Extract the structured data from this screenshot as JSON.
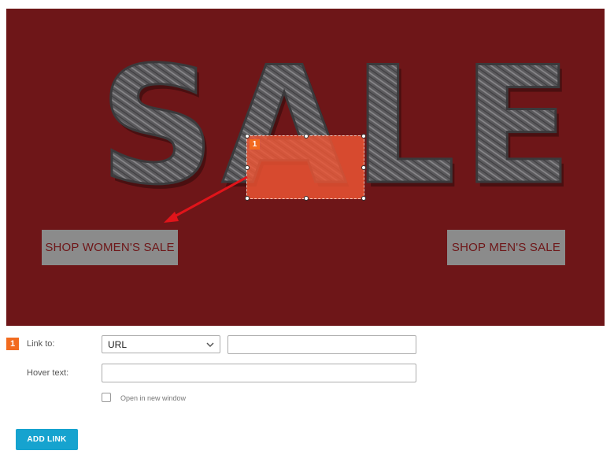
{
  "banner": {
    "headline": "SALE",
    "women_button": "SHOP WOMEN'S SALE",
    "men_button": "SHOP MEN'S SALE",
    "hotspot_number": "1"
  },
  "form": {
    "row_number": "1",
    "link_to_label": "Link to:",
    "link_type_value": "URL",
    "url_value": "",
    "hover_text_label": "Hover text:",
    "hover_text_value": "",
    "open_new_window_label": "Open in new window",
    "open_new_window_checked": false,
    "add_link_label": "ADD LINK"
  },
  "colors": {
    "banner_bg": "#6e1618",
    "hotspot": "#ee5634",
    "arrow": "#e0141a",
    "badge": "#f26b1f",
    "add_button": "#16a3cf"
  }
}
